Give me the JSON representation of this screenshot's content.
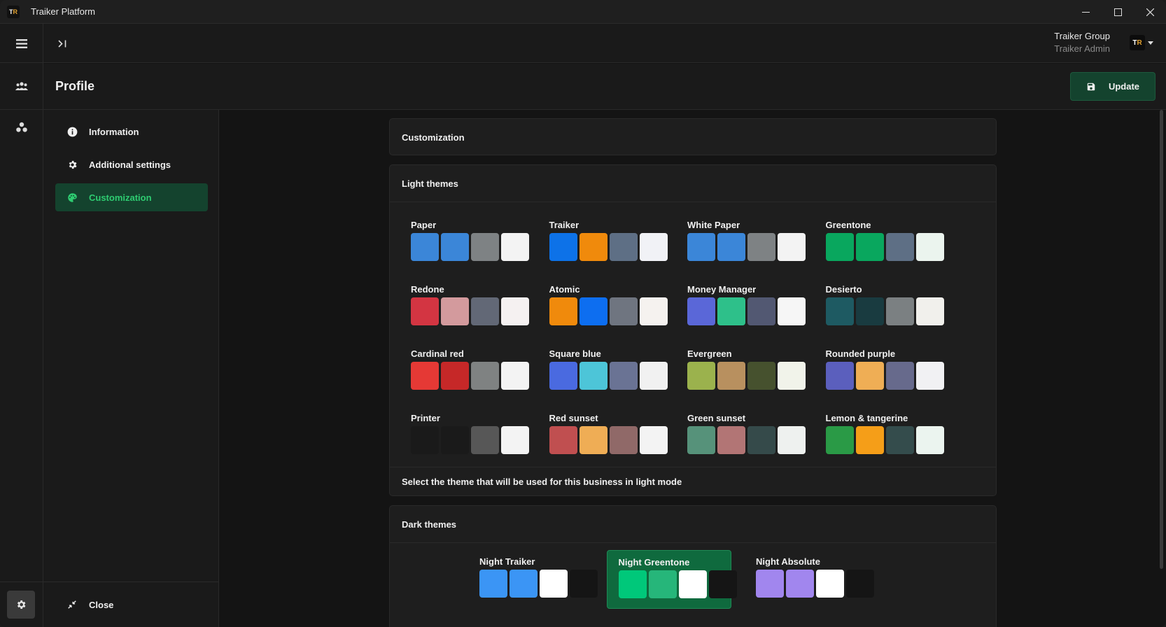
{
  "window": {
    "title": "Traiker Platform",
    "logo": "TR"
  },
  "header": {
    "org": "Traiker Group",
    "role": "Traiker Admin",
    "avatar": "TR"
  },
  "page": {
    "title": "Profile",
    "update_label": "Update"
  },
  "sidebar": {
    "items": [
      {
        "label": "Information",
        "icon": "info-icon"
      },
      {
        "label": "Additional settings",
        "icon": "gear-icon"
      },
      {
        "label": "Customization",
        "icon": "palette-icon"
      }
    ],
    "close_label": "Close"
  },
  "customization": {
    "title": "Customization"
  },
  "light": {
    "title": "Light themes",
    "footer": "Select the theme that will be used for this business in light mode",
    "themes": [
      {
        "name": "Paper",
        "colors": [
          "#3b86d8",
          "#3b86d8",
          "#7e8284",
          "#f3f3f3"
        ]
      },
      {
        "name": "Traiker",
        "colors": [
          "#0d72e8",
          "#f08a0c",
          "#5e6f85",
          "#f1f2f6"
        ]
      },
      {
        "name": "White Paper",
        "colors": [
          "#3b86d8",
          "#3b86d8",
          "#7e8284",
          "#f3f3f3"
        ]
      },
      {
        "name": "Greentone",
        "colors": [
          "#09a75e",
          "#09a75e",
          "#5e6f85",
          "#ebf4ee"
        ]
      },
      {
        "name": "Redone",
        "colors": [
          "#d33542",
          "#d39a9d",
          "#626876",
          "#f5f1f1"
        ]
      },
      {
        "name": "Atomic",
        "colors": [
          "#f08a0c",
          "#0d6ef0",
          "#6f7580",
          "#f5f2ef"
        ]
      },
      {
        "name": "Money Manager",
        "colors": [
          "#5a67d8",
          "#2ec08a",
          "#525872",
          "#f6f6f6"
        ]
      },
      {
        "name": "Desierto",
        "colors": [
          "#1e5a62",
          "#193b40",
          "#7b8082",
          "#f1f0ec"
        ]
      },
      {
        "name": "Cardinal red",
        "colors": [
          "#e53935",
          "#c62828",
          "#7f8282",
          "#f3f3f3"
        ]
      },
      {
        "name": "Square blue",
        "colors": [
          "#4a6ae0",
          "#4dc5d8",
          "#6a7394",
          "#f1f1f1"
        ]
      },
      {
        "name": "Evergreen",
        "colors": [
          "#9bb24d",
          "#b8905f",
          "#46512e",
          "#f1f3ea"
        ]
      },
      {
        "name": "Rounded purple",
        "colors": [
          "#5b5fbd",
          "#efae55",
          "#676a8c",
          "#f1f1f3"
        ]
      },
      {
        "name": "Printer",
        "colors": [
          "#1a1a1a",
          "#1a1a1a",
          "#575757",
          "#f3f3f3"
        ]
      },
      {
        "name": "Red sunset",
        "colors": [
          "#c04f50",
          "#efad55",
          "#906968",
          "#f3f3f3"
        ]
      },
      {
        "name": "Green sunset",
        "colors": [
          "#56927a",
          "#b27575",
          "#354a4a",
          "#eef1ef"
        ]
      },
      {
        "name": "Lemon & tangerine",
        "colors": [
          "#2a9a46",
          "#f59e18",
          "#344c4c",
          "#ebf4ef"
        ]
      }
    ]
  },
  "dark": {
    "title": "Dark themes",
    "themes": [
      {
        "name": "Night Traiker",
        "colors": [
          "#3b95f5",
          "#3b95f5",
          "#ffffff",
          "#151515"
        ],
        "selected": false
      },
      {
        "name": "Night Greentone",
        "colors": [
          "#00c87a",
          "#26b67a",
          "#ffffff",
          "#151515"
        ],
        "selected": true
      },
      {
        "name": "Night Absolute",
        "colors": [
          "#a186ee",
          "#a186ee",
          "#ffffff",
          "#151515"
        ],
        "selected": false
      }
    ]
  },
  "colors": {
    "accent": "#2ecc71",
    "accent_bg": "#14432e"
  }
}
